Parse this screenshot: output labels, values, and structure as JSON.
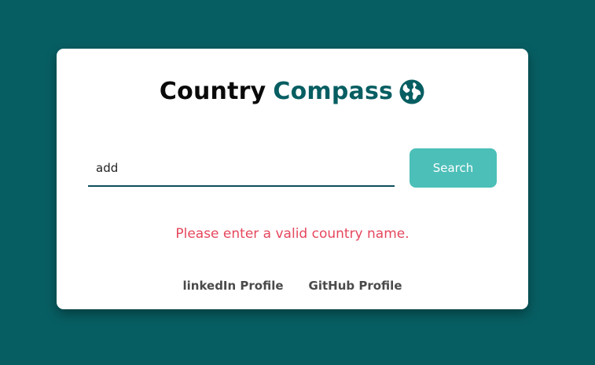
{
  "header": {
    "title_part1": "Country",
    "title_part2": "Compass",
    "icon": "globe-icon"
  },
  "search": {
    "value": "add",
    "button_label": "Search"
  },
  "error_message": "Please enter a valid country name.",
  "footer": {
    "linkedin_label": "linkedIn Profile",
    "github_label": "GitHub Profile"
  },
  "colors": {
    "background": "#075e62",
    "accent": "#075e62",
    "button": "#4cbfb8",
    "error": "#e5475d"
  }
}
